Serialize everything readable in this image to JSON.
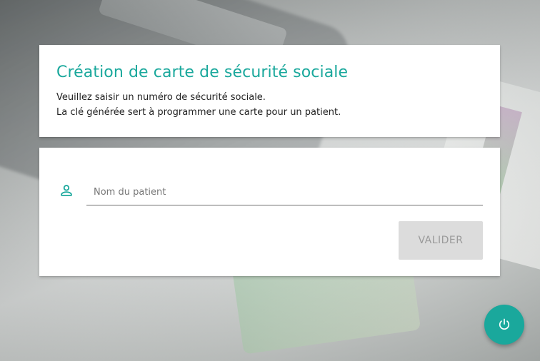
{
  "header": {
    "title": "Création de carte de sécurité sociale",
    "line1": "Veuillez saisir un numéro de sécurité sociale.",
    "line2": "La clé générée sert à programmer une carte pour un patient."
  },
  "form": {
    "patient_name": {
      "placeholder": "Nom du patient",
      "value": "",
      "icon": "person-icon"
    },
    "submit_label": "VALIDER"
  },
  "fab": {
    "icon": "power-icon"
  },
  "colors": {
    "accent": "#1aa89c",
    "button_disabled_bg": "#dcdcdc",
    "button_disabled_text": "#9a9a9a"
  }
}
